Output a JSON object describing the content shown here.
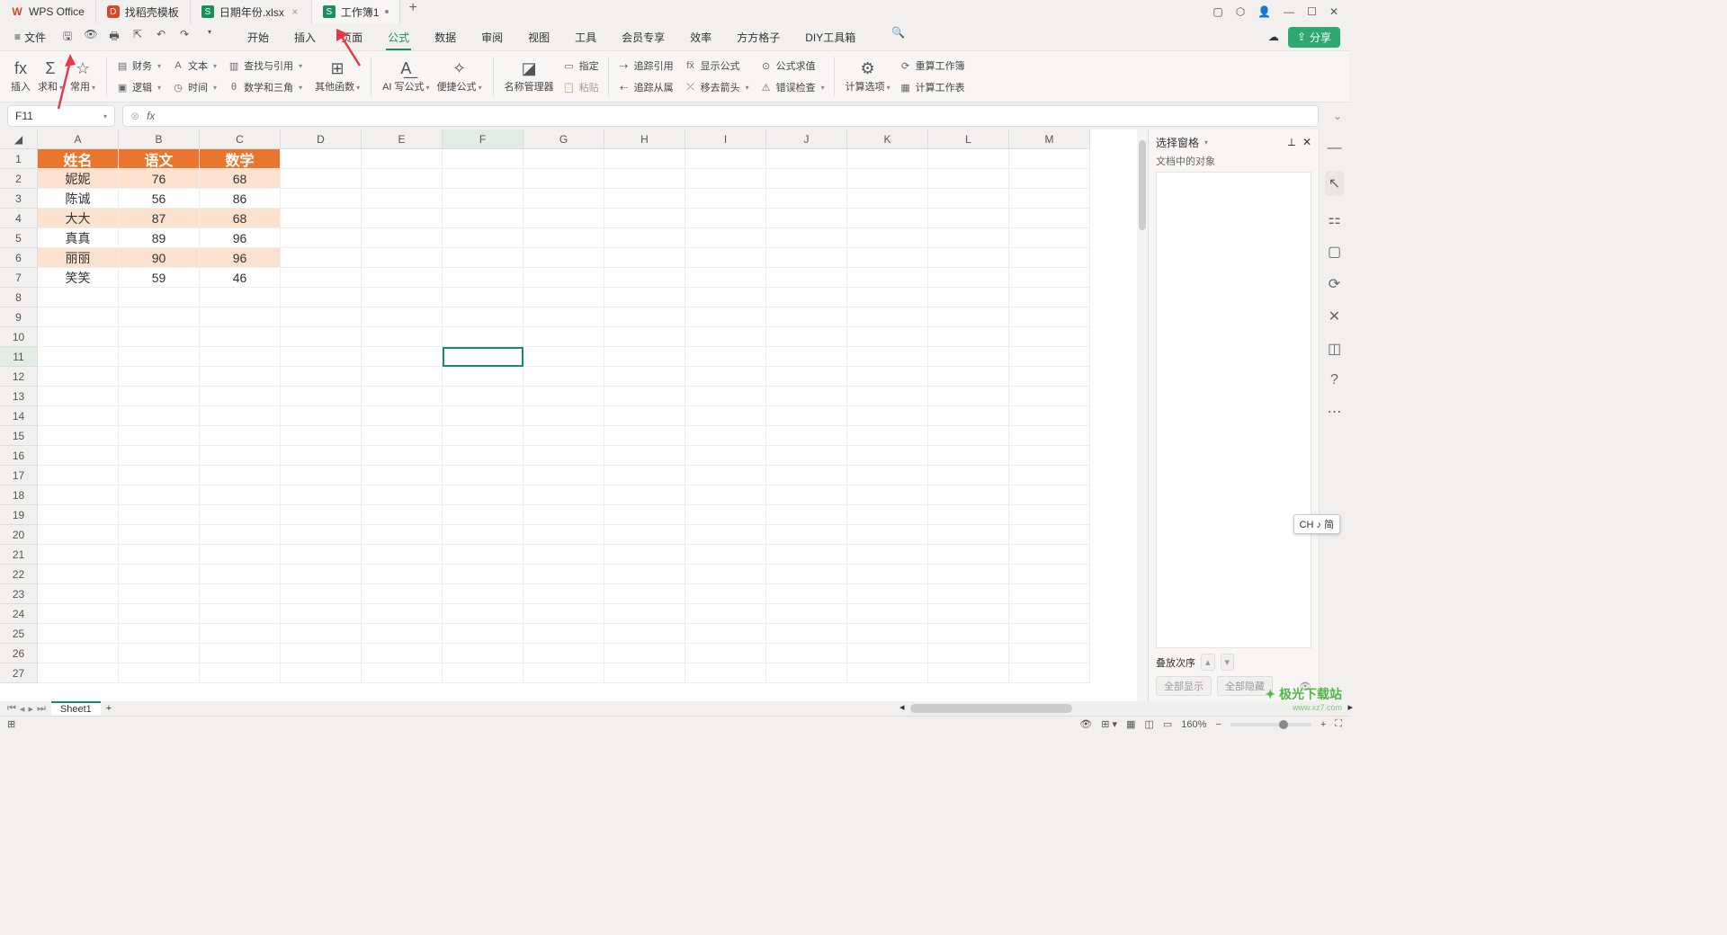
{
  "tabs": [
    {
      "label": "WPS Office",
      "icon_color": "#d9452b"
    },
    {
      "label": "找稻壳模板",
      "icon_color": "#d9452b"
    },
    {
      "label": "日期年份.xlsx",
      "icon_color": "#1a8f5c",
      "closable": true
    },
    {
      "label": "工作簿1",
      "icon_color": "#1a8f5c",
      "active": true,
      "dirty": true
    }
  ],
  "file_menu": {
    "label": "文件"
  },
  "menu": {
    "items": [
      "开始",
      "插入",
      "页面",
      "公式",
      "数据",
      "审阅",
      "视图",
      "工具",
      "会员专享",
      "效率",
      "方方格子",
      "DIY工具箱"
    ],
    "active": "公式"
  },
  "share_label": "分享",
  "ribbon": {
    "insert_fn": "插入",
    "sum": "求和",
    "common": "常用",
    "finance": "财务",
    "text": "文本",
    "lookup": "查找与引用",
    "logic": "逻辑",
    "time": "时间",
    "math": "数学和三角",
    "other": "其他函数",
    "ai": "写公式",
    "quick_fx": "便捷公式",
    "name_mgr": "名称管理器",
    "define": "指定",
    "paste": "粘贴",
    "trace_ref": "追踪引用",
    "show_fx": "显示公式",
    "eval": "公式求值",
    "trace_dep": "追踪从属",
    "remove_arrow": "移去箭头",
    "err_check": "错误检查",
    "calc_opt": "计算选项",
    "recalc_book": "重算工作簿",
    "calc_sheet": "计算工作表"
  },
  "name_box": "F11",
  "fx_prefix": "fx",
  "columns": [
    "A",
    "B",
    "C",
    "D",
    "E",
    "F",
    "G",
    "H",
    "I",
    "J",
    "K",
    "L",
    "M"
  ],
  "row_count": 27,
  "selected_cell": "F11",
  "selected_row": 11,
  "selected_col": "F",
  "table": {
    "headers": [
      "姓名",
      "语文",
      "数学"
    ],
    "rows": [
      [
        "妮妮",
        "76",
        "68"
      ],
      [
        "陈诚",
        "56",
        "86"
      ],
      [
        "大大",
        "87",
        "68"
      ],
      [
        "真真",
        "89",
        "96"
      ],
      [
        "丽丽",
        "90",
        "96"
      ],
      [
        "笑笑",
        "59",
        "46"
      ]
    ]
  },
  "right_panel": {
    "title": "选择窗格",
    "subtitle": "文档中的对象",
    "stack": "叠放次序",
    "show_all": "全部显示",
    "hide_all": "全部隐藏"
  },
  "sheet_tabs": {
    "active": "Sheet1"
  },
  "status": {
    "zoom": "160%"
  },
  "ime": "CH ♪ 简",
  "watermark": {
    "name": "极光下载站",
    "url": "www.xz7.com"
  }
}
